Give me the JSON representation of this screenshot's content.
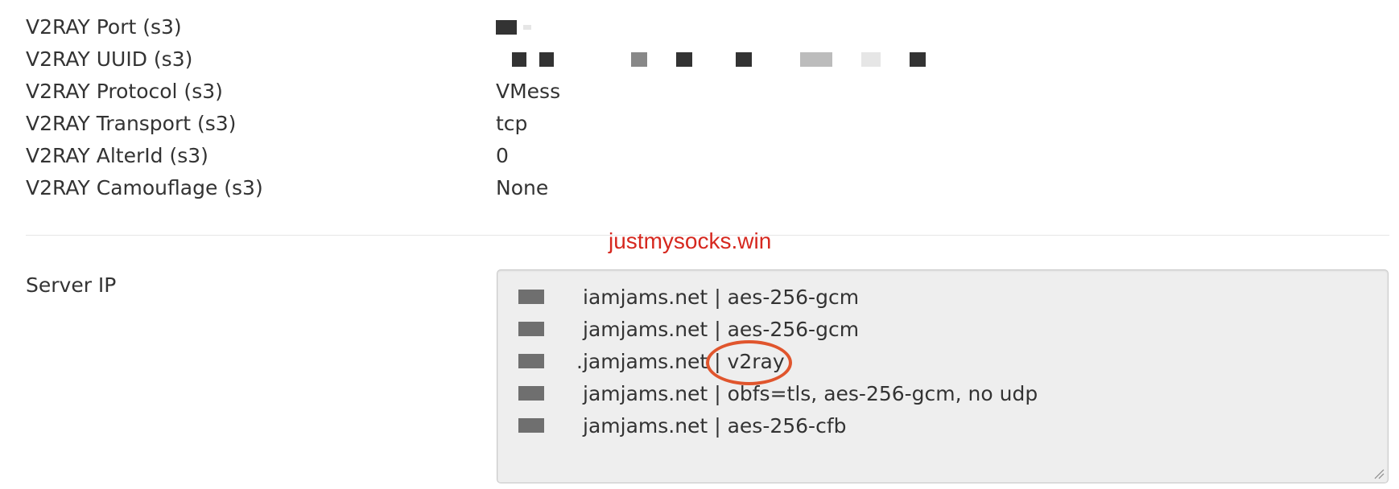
{
  "v2ray_fields": [
    {
      "label": "V2RAY Port (s3)",
      "value": ""
    },
    {
      "label": "V2RAY UUID (s3)",
      "value": ""
    },
    {
      "label": "V2RAY Protocol (s3)",
      "value": "VMess"
    },
    {
      "label": "V2RAY Transport (s3)",
      "value": "tcp"
    },
    {
      "label": "V2RAY AlterId (s3)",
      "value": "0"
    },
    {
      "label": "V2RAY Camouflage (s3)",
      "value": "None"
    }
  ],
  "watermark": "justmysocks.win",
  "server_ip": {
    "label": "Server IP",
    "lines": [
      {
        "host": "iamjams.net",
        "separator": "|",
        "detail": "aes-256-gcm"
      },
      {
        "host": "jamjams.net",
        "separator": "|",
        "detail": "aes-256-gcm"
      },
      {
        "host": ".jamjams.net",
        "separator": "|",
        "detail": "v2ray"
      },
      {
        "host": "jamjams.net",
        "separator": "|",
        "detail": "obfs=tls, aes-256-gcm, no udp"
      },
      {
        "host": "jamjams.net",
        "separator": "|",
        "detail": "aes-256-cfb"
      }
    ]
  },
  "annotation": {
    "highlighted_text": "v2ray",
    "color": "#e0552d"
  },
  "colors": {
    "watermark": "#d6281f",
    "text": "#333333",
    "textarea_bg": "#eeeeee"
  }
}
